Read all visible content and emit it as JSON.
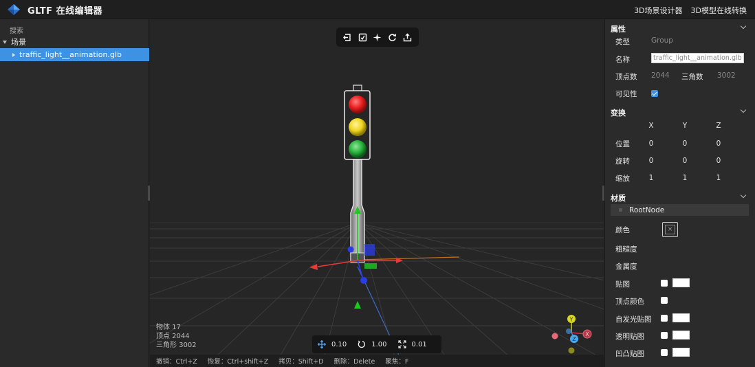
{
  "app": {
    "title": "GLTF 在线编辑器",
    "links": [
      "3D场景设计器",
      "3D模型在线转换"
    ]
  },
  "left_panel": {
    "search_label": "搜索",
    "scene_label": "场景",
    "node_label": "traffic_light__animation.glb"
  },
  "viewport": {
    "toolbar_icons": [
      "import-icon",
      "export-scene-icon",
      "light-icon",
      "reset-view-icon",
      "share-icon"
    ],
    "stats": {
      "objects": "物体 17",
      "vertices": "顶点 2044",
      "triangles": "三角形 3002"
    },
    "snap": {
      "translate": "0.10",
      "rotate": "1.00",
      "scale": "0.01"
    },
    "hotkeys": [
      "撤销：Ctrl+Z",
      "恢复：Ctrl+shift+Z",
      "拷贝：Shift+D",
      "删除：Delete",
      "聚焦：F"
    ],
    "axis_colors": {
      "x": "#e83a3a",
      "y": "#1fc71f",
      "z": "#2a3ce8"
    }
  },
  "properties": {
    "section_title": "属性",
    "type_label": "类型",
    "type_value": "Group",
    "name_label": "名称",
    "name_value": "traffic_light__animation.glb",
    "vertex_label": "顶点数",
    "vertex_value": "2044",
    "triangle_label": "三角数",
    "triangle_value": "3002",
    "visible_label": "可见性",
    "visible": true
  },
  "transform": {
    "section_title": "变换",
    "headers": [
      "X",
      "Y",
      "Z"
    ],
    "position_label": "位置",
    "position": [
      "0",
      "0",
      "0"
    ],
    "rotation_label": "旋转",
    "rotation": [
      "0",
      "0",
      "0"
    ],
    "scale_label": "缩放",
    "scale": [
      "1",
      "1",
      "1"
    ]
  },
  "material": {
    "section_title": "材质",
    "material_name": "RootNode",
    "color_label": "颜色",
    "color_glyph": "×",
    "roughness_label": "粗糙度",
    "metalness_label": "金属度",
    "map_label": "贴图",
    "vertex_color_label": "顶点颜色",
    "emissive_map_label": "自发光贴图",
    "alpha_map_label": "透明贴图",
    "bump_map_label": "凹凸贴图"
  },
  "accent_color": "#3d92e4"
}
